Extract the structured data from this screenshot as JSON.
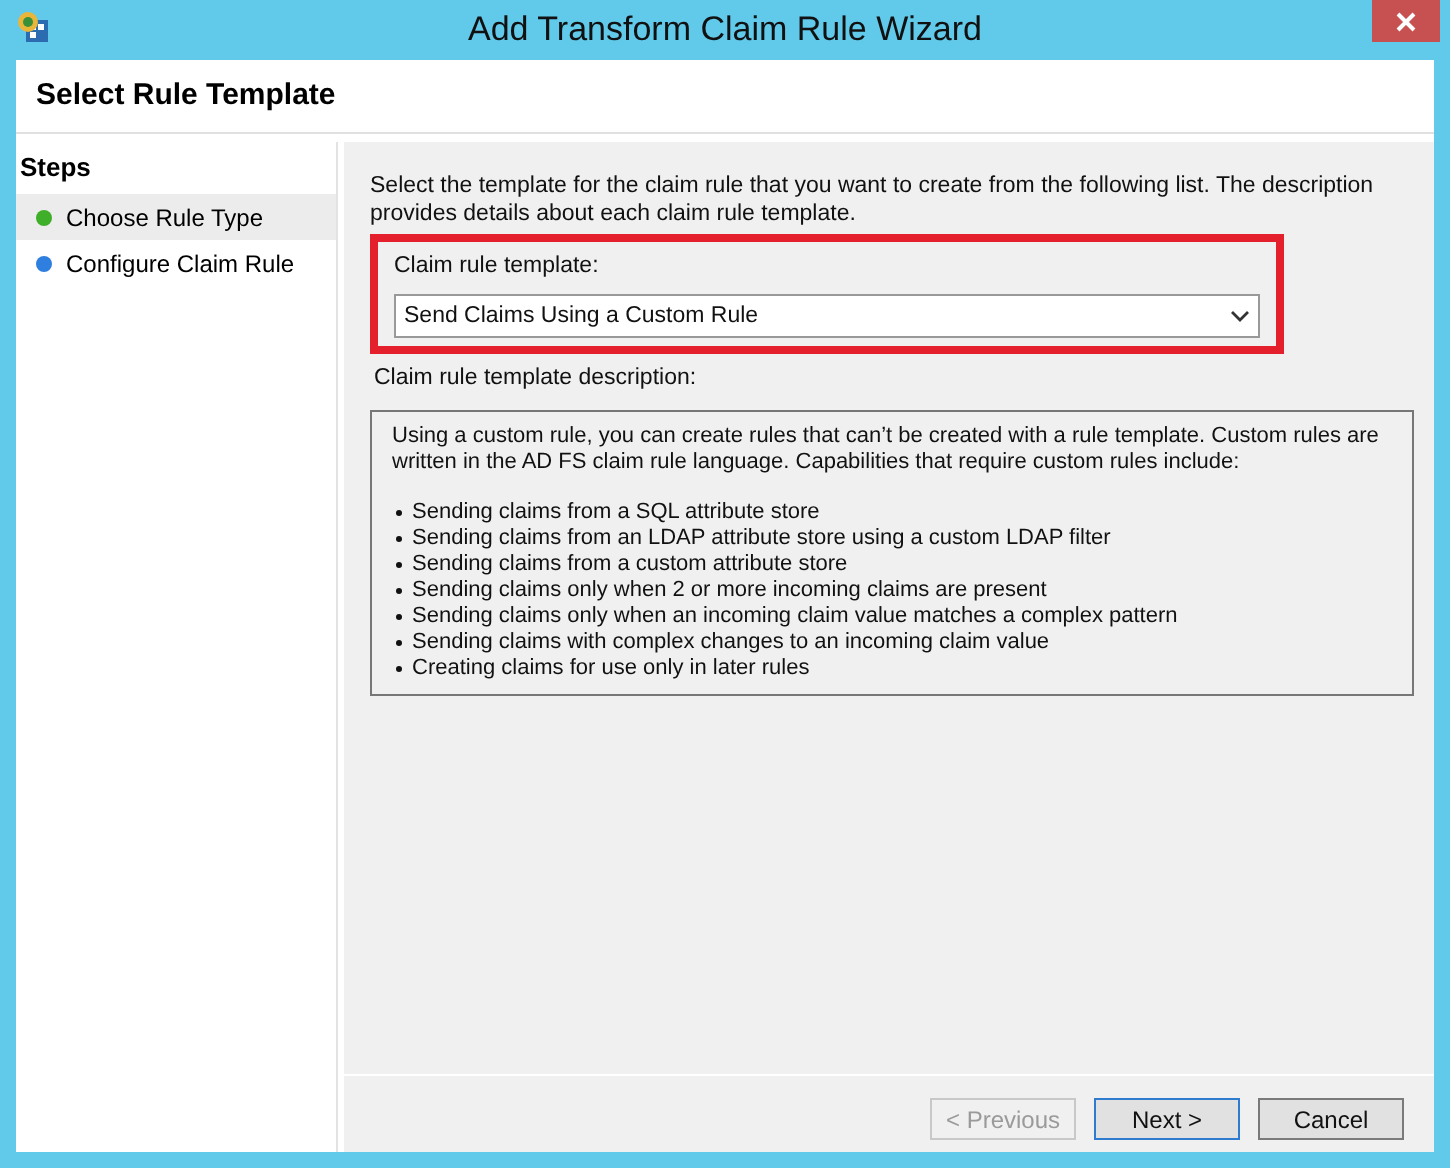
{
  "window": {
    "title": "Add Transform Claim Rule Wizard"
  },
  "header": {
    "title": "Select Rule Template"
  },
  "steps": {
    "title": "Steps",
    "items": [
      {
        "label": "Choose Rule Type",
        "selected": true,
        "color": "#3fae29"
      },
      {
        "label": "Configure Claim Rule",
        "selected": false,
        "color": "#2f7fe0"
      }
    ]
  },
  "intro": "Select the template for the claim rule that you want to create from the following list. The description provides details about each claim rule template.",
  "template": {
    "label": "Claim rule template:",
    "value": "Send Claims Using a Custom Rule"
  },
  "description": {
    "label": "Claim rule template description:",
    "text": "Using a custom rule, you can create rules that can’t be created with a rule template.  Custom rules are written in the AD FS claim rule language.  Capabilities that require custom rules include:",
    "bullets": [
      "Sending claims from a SQL attribute store",
      "Sending claims from an LDAP attribute store using a custom LDAP filter",
      "Sending claims from a custom attribute store",
      "Sending claims only when 2 or more incoming claims are present",
      "Sending claims only when an incoming claim value matches a complex pattern",
      "Sending claims with complex changes to an incoming claim value",
      "Creating claims for use only in later rules"
    ]
  },
  "buttons": [
    {
      "label": "< Previous",
      "disabled": true,
      "default": false
    },
    {
      "label": "Next >",
      "disabled": false,
      "default": true
    },
    {
      "label": "Cancel",
      "disabled": false,
      "default": false
    }
  ]
}
